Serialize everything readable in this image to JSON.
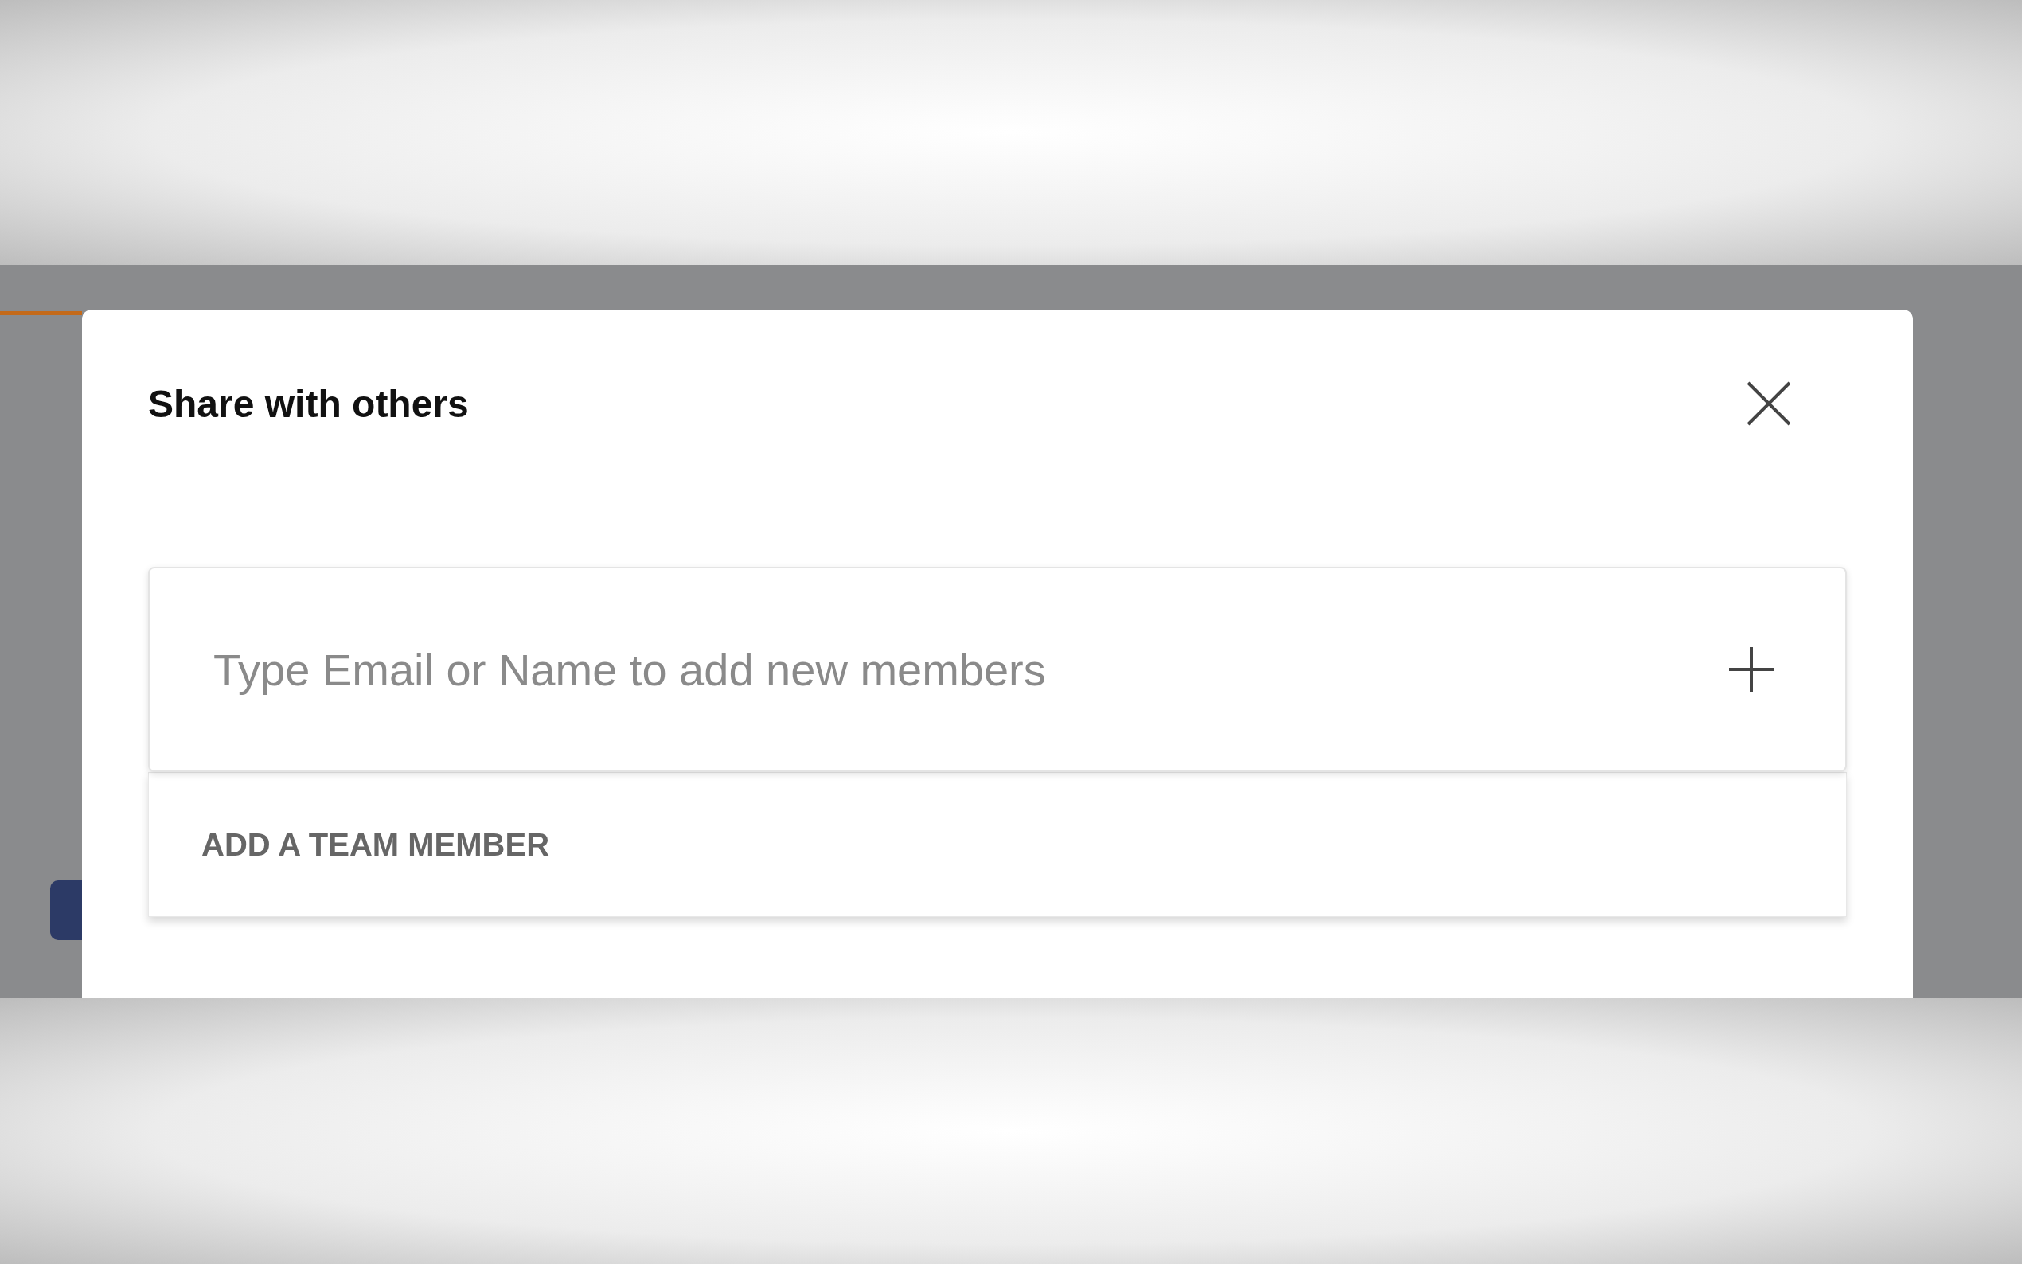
{
  "dialog": {
    "title": "Share with others",
    "search": {
      "placeholder": "Type Email or Name to add new members"
    },
    "suggestions": [
      {
        "label": "ADD A TEAM MEMBER"
      }
    ]
  }
}
